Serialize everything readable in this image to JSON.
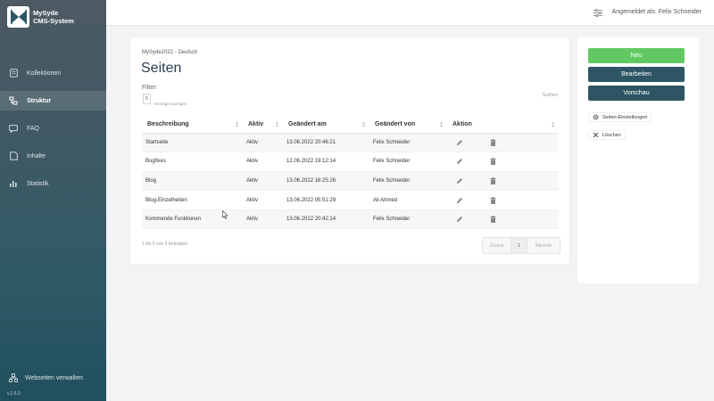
{
  "brand": {
    "line1": "MySyde",
    "line2": "CMS-System"
  },
  "sidebar": {
    "items": [
      {
        "label": "Kollektionen",
        "icon": "document-icon",
        "active": false
      },
      {
        "label": "Struktur",
        "icon": "sitemap-icon",
        "active": true
      },
      {
        "label": "FAQ",
        "icon": "chat-icon",
        "active": false
      },
      {
        "label": "Inhalte",
        "icon": "file-icon",
        "active": false
      },
      {
        "label": "Statistik",
        "icon": "bar-chart-icon",
        "active": false
      }
    ],
    "footer_label": "Webseiten verwalten",
    "version": "v.2.6.0"
  },
  "header": {
    "login_text": "Angemeldet als: Felix Schneider"
  },
  "page": {
    "breadcrumb": "MySyde2022 - Deutsch",
    "title": "Seiten",
    "filter_label": "Filter:",
    "length_value": "5",
    "length_label": "Einträge anzeigen",
    "search_label": "Suchen:"
  },
  "table": {
    "columns": [
      "Beschreibung",
      "Aktiv",
      "Geändert am",
      "Geändert von",
      "Aktion"
    ],
    "rows": [
      {
        "beschreibung": "Startseite",
        "aktiv": "Aktiv",
        "geaendert_am": "13.06.2022 20:46:21",
        "geaendert_von": "Felix Schneider"
      },
      {
        "beschreibung": "Bugfixes",
        "aktiv": "Aktiv",
        "geaendert_am": "12.06.2022 19:12:14",
        "geaendert_von": "Felix Schneider"
      },
      {
        "beschreibung": "Blog",
        "aktiv": "Aktiv",
        "geaendert_am": "13.06.2022 16:25:26",
        "geaendert_von": "Felix Schneider"
      },
      {
        "beschreibung": "Blog-Einzelheiten",
        "aktiv": "Aktiv",
        "geaendert_am": "13.06.2022 05:51:29",
        "geaendert_von": "Ali Ahmed"
      },
      {
        "beschreibung": "Kommende Funktionen",
        "aktiv": "Aktiv",
        "geaendert_am": "13.06.2022 20:42:14",
        "geaendert_von": "Felix Schneider"
      }
    ],
    "info": "1 bis 5 von 5 Einträgen",
    "pager": {
      "prev": "Zurück",
      "current": "1",
      "next": "Nächste"
    }
  },
  "panel": {
    "new_label": "Neu",
    "edit_label": "Bearbeiten",
    "preview_label": "Vorschau",
    "settings_label": "Seiten-Einstellungen",
    "delete_label": "Löschen"
  },
  "colors": {
    "accent_green": "#62c962",
    "accent_dark": "#2d5563",
    "sidebar_dark": "#214f5d"
  }
}
